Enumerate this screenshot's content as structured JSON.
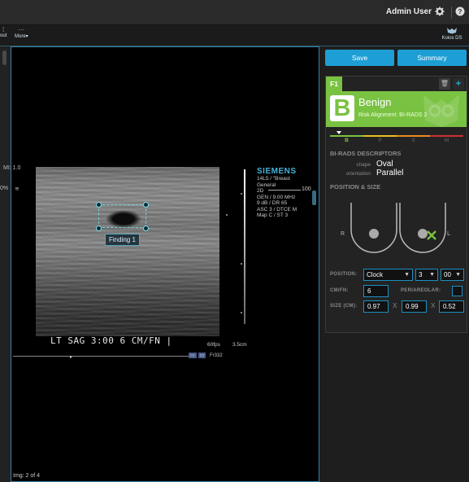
{
  "header": {
    "user": "Admin User"
  },
  "toolbar": {
    "items": [
      {
        "label": "out"
      },
      {
        "label": "More▾"
      }
    ],
    "koios": "Koios DS"
  },
  "viewer": {
    "ruler_mi": "MI: 1.0",
    "ruler_pct": "0%",
    "finding_label": "Finding 1",
    "manufacturer": "SIEMENS",
    "params": [
      "14L5 / \"Breast",
      "General",
      "2D",
      "GEN / 9.00 MHz",
      "9 dB / DR 65",
      "ASC 3 / DTCE M",
      "Map C / ST 3"
    ],
    "gain_value": "100",
    "caption": "LT SAG 3:00 6 CM/FN |",
    "fps": "60fps",
    "depth": "3.5cm",
    "frame": "Fr332",
    "image_count": "Img: 2 of 4"
  },
  "panel": {
    "save": "Save",
    "summary": "Summary",
    "finding_tab": "F1",
    "class_letter": "B",
    "class_title": "Benign",
    "risk": "Risk Alignment: BI-RADS 2",
    "scale": [
      "B",
      "P",
      "S",
      "M"
    ],
    "scale_colors": [
      "#7ac242",
      "#e8c020",
      "#e88a20",
      "#d03030"
    ],
    "descriptors_title": "BI-RADS DESCRIPTORS",
    "shape_label": "shape",
    "shape_value": "Oval",
    "orientation_label": "orientation",
    "orientation_value": "Parallel",
    "position_title": "POSITION & SIZE",
    "right_label": "R",
    "left_label": "L",
    "position_label": "POSITION:",
    "position_value": "Clock",
    "clock_hour": "3",
    "clock_min": "00",
    "cmfn_label": "CM/FN:",
    "cmfn_value": "6",
    "periareolar_label": "PERIAREOLAR:",
    "size_label": "SIZE (CM):",
    "size": [
      "0.97",
      "0.99",
      "0.52"
    ],
    "x_sep": "X"
  }
}
